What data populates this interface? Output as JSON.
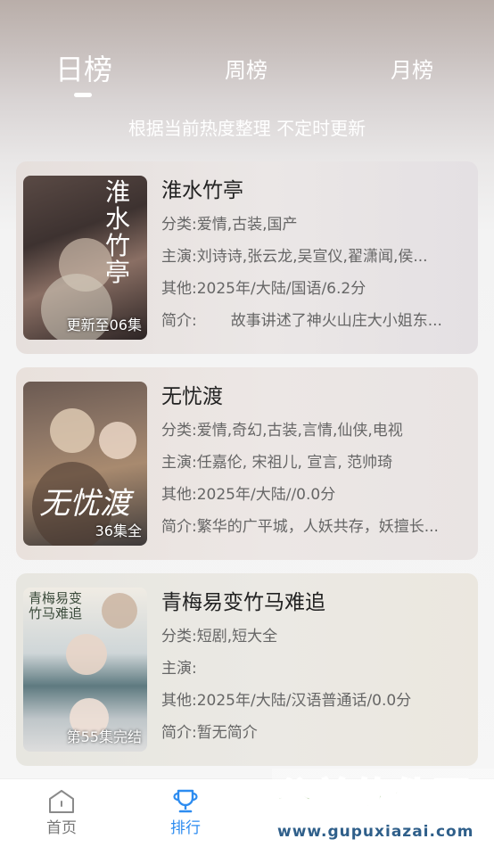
{
  "tabs": {
    "daily": "日榜",
    "weekly": "周榜",
    "monthly": "月榜"
  },
  "subtitle": "根据当前热度整理 不定时更新",
  "labels": {
    "category": "分类:",
    "cast": "主演:",
    "other": "其他:",
    "intro": "简介:"
  },
  "items": [
    {
      "title": "淮水竹亭",
      "category": "爱情,古装,国产",
      "cast": "刘诗诗,张云龙,吴宣仪,翟潇闻,侯...",
      "other": "2025年/大陆/国语/6.2分",
      "intro": "故事讲述了神火山庄大小姐东...",
      "badge": "更新至06集",
      "poster_text": "淮水竹亭"
    },
    {
      "title": "无忧渡",
      "category": "爱情,奇幻,古装,言情,仙侠,电视",
      "cast": "任嘉伦, 宋祖儿, 宣言, 范帅琦",
      "other": "2025年/大陆//0.0分",
      "intro": "繁华的广平城，人妖共存，妖擅长...",
      "badge": "36集全",
      "poster_text": "无忧渡"
    },
    {
      "title": "青梅易变竹马难追",
      "category": "短剧,短大全",
      "cast": "",
      "other": "2025年/大陆/汉语普通话/0.0分",
      "intro": "暂无简介",
      "badge": "第55集完结",
      "poster_text": "青梅易变竹马难追"
    }
  ],
  "nav": {
    "home": "首页",
    "ranking": "排行",
    "active_color": "#2d8cf0"
  },
  "watermark": {
    "name": "谷普软件园",
    "url": "www.gupuxiazai.com"
  }
}
